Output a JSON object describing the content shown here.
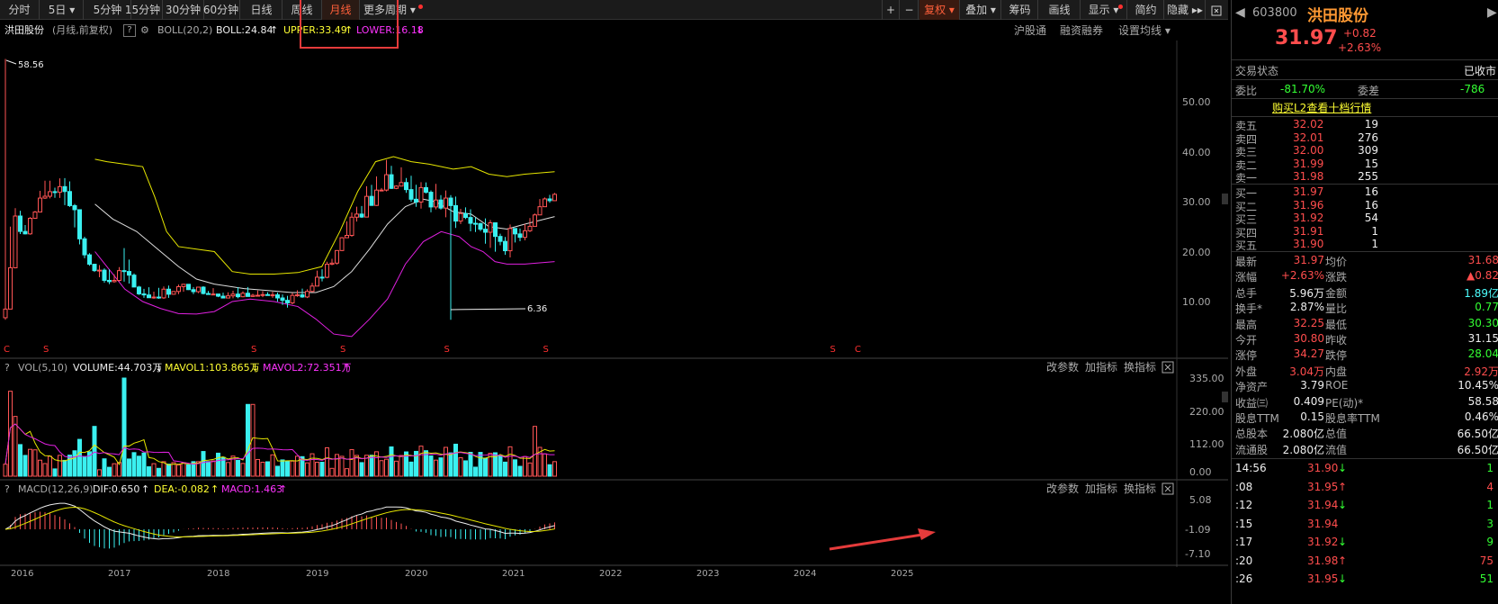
{
  "toolbar": {
    "items": [
      "分时",
      "5日",
      "5分钟",
      "15分钟",
      "30分钟",
      "60分钟",
      "日线",
      "周线",
      "月线",
      "更多周期"
    ],
    "right": [
      "+",
      "−",
      "复权",
      "叠加",
      "筹码",
      "画线",
      "显示",
      "简约",
      "隐藏"
    ]
  },
  "info": {
    "name": "洪田股份",
    "mode": "(月线,前复权)",
    "help": "?",
    "boll": "BOLL(20,2)",
    "boll_val": "BOLL:24.84",
    "upper": "UPPER:33.49",
    "lower": "LOWER:16.18",
    "links": [
      "沪股通",
      "融资融券",
      "设置均线"
    ]
  },
  "price_axis": [
    "50.00",
    "40.00",
    "30.00",
    "20.00",
    "10.00"
  ],
  "annot": {
    "high": "58.56",
    "low": "6.36"
  },
  "vol": {
    "title": "VOL(5,10)",
    "volume": "VOLUME:44.703万",
    "mavol1": "MAVOL1:103.865万",
    "mavol2": "MAVOL2:72.351万",
    "axis": [
      "335.00",
      "220.00",
      "112.00",
      "0.00"
    ]
  },
  "macd": {
    "title": "MACD(12,26,9)",
    "dif": "DIF:0.650",
    "dea": "DEA:-0.082",
    "macd": "MACD:1.463",
    "axis": [
      "5.08",
      "-1.09",
      "-7.10"
    ]
  },
  "sub_links": [
    "改参数",
    "加指标",
    "换指标"
  ],
  "years": [
    "2016",
    "2017",
    "2018",
    "2019",
    "2020",
    "2021",
    "2022",
    "2023",
    "2024",
    "2025"
  ],
  "sidebar": {
    "code": "603800",
    "name": "洪田股份",
    "price": "31.97",
    "chg": "+0.82",
    "pct": "+2.63%",
    "status_label": "交易状态",
    "status": "已收市",
    "webi_label": "委比",
    "webi": "-81.70%",
    "wecha_label": "委差",
    "wecha": "-786",
    "l2": "购买L2查看十档行情",
    "asks": [
      {
        "l": "卖五",
        "p": "32.02",
        "v": "19"
      },
      {
        "l": "卖四",
        "p": "32.01",
        "v": "276"
      },
      {
        "l": "卖三",
        "p": "32.00",
        "v": "309"
      },
      {
        "l": "卖二",
        "p": "31.99",
        "v": "15"
      },
      {
        "l": "卖一",
        "p": "31.98",
        "v": "255"
      }
    ],
    "bids": [
      {
        "l": "买一",
        "p": "31.97",
        "v": "16"
      },
      {
        "l": "买二",
        "p": "31.96",
        "v": "16"
      },
      {
        "l": "买三",
        "p": "31.92",
        "v": "54"
      },
      {
        "l": "买四",
        "p": "31.91",
        "v": "1"
      },
      {
        "l": "买五",
        "p": "31.90",
        "v": "1"
      }
    ],
    "stats": [
      {
        "l1": "最新",
        "v1": "31.97",
        "l2": "均价",
        "v2": "31.68"
      },
      {
        "l1": "涨幅",
        "v1": "+2.63%",
        "l2": "涨跌",
        "v2": "▲0.82"
      },
      {
        "l1": "总手",
        "v1": "5.96万",
        "l2": "金额",
        "v2": "1.89亿"
      },
      {
        "l1": "换手*",
        "v1": "2.87%",
        "l2": "量比",
        "v2": "0.77"
      },
      {
        "l1": "最高",
        "v1": "32.25",
        "l2": "最低",
        "v2": "30.30"
      },
      {
        "l1": "今开",
        "v1": "30.80",
        "l2": "昨收",
        "v2": "31.15"
      },
      {
        "l1": "涨停",
        "v1": "34.27",
        "l2": "跌停",
        "v2": "28.04"
      },
      {
        "l1": "外盘",
        "v1": "3.04万",
        "l2": "内盘",
        "v2": "2.92万"
      },
      {
        "l1": "净资产",
        "v1": "3.79",
        "l2": "ROE",
        "v2": "10.45%"
      },
      {
        "l1": "收益㈢",
        "v1": "0.409",
        "l2": "PE(动)*",
        "v2": "58.58"
      },
      {
        "l1": "股息TTM",
        "v1": "0.15",
        "l2": "股息率TTM",
        "v2": "0.46%"
      },
      {
        "l1": "总股本",
        "v1": "2.080亿",
        "l2": "总值",
        "v2": "66.50亿"
      },
      {
        "l1": "流通股",
        "v1": "2.080亿",
        "l2": "流值",
        "v2": "66.50亿"
      }
    ],
    "ticks": [
      {
        "t": "14:56",
        "p": "31.90",
        "a": "↓",
        "v": "1"
      },
      {
        "t": ":08",
        "p": "31.95",
        "a": "↑",
        "v": "4"
      },
      {
        "t": ":12",
        "p": "31.94",
        "a": "↓",
        "v": "1"
      },
      {
        "t": ":15",
        "p": "31.94",
        "a": "",
        "v": "3"
      },
      {
        "t": ":17",
        "p": "31.92",
        "a": "↓",
        "v": "9"
      },
      {
        "t": ":20",
        "p": "31.98",
        "a": "↑",
        "v": "75"
      },
      {
        "t": ":26",
        "p": "31.95",
        "a": "↓",
        "v": "51"
      }
    ]
  },
  "chart_data": {
    "type": "candlestick",
    "months": 112,
    "price_range": [
      0,
      60
    ],
    "anchors": [
      [
        0,
        7,
        58.6,
        4
      ],
      [
        3,
        26,
        32,
        24
      ],
      [
        6,
        24,
        28,
        22
      ],
      [
        10,
        28,
        30,
        26
      ],
      [
        14,
        32,
        38,
        30
      ],
      [
        17,
        33,
        40,
        30
      ],
      [
        20,
        34,
        52,
        26
      ],
      [
        23,
        27,
        32,
        22
      ],
      [
        26,
        20,
        24,
        18
      ],
      [
        30,
        17,
        20,
        15
      ],
      [
        34,
        14,
        17,
        12
      ],
      [
        39,
        15,
        27,
        13
      ],
      [
        44,
        12,
        14,
        10
      ],
      [
        49,
        11,
        14,
        10
      ],
      [
        54,
        12,
        14,
        10
      ],
      [
        60,
        13,
        14,
        11
      ],
      [
        68,
        12,
        14,
        11
      ],
      [
        76,
        11,
        14,
        10
      ],
      [
        84,
        12,
        14,
        11
      ],
      [
        89,
        11,
        13,
        10
      ],
      [
        93,
        9,
        12,
        6.4
      ],
      [
        97,
        11,
        13,
        10
      ],
      [
        102,
        12,
        14,
        11
      ],
      [
        107,
        16,
        22,
        14
      ],
      [
        112,
        22,
        28,
        20
      ],
      [
        116,
        26,
        32,
        24
      ],
      [
        122,
        30,
        38,
        28
      ],
      [
        127,
        36,
        45,
        33
      ],
      [
        132,
        33,
        40,
        30
      ],
      [
        138,
        31,
        38,
        28
      ],
      [
        144,
        30,
        36,
        26
      ],
      [
        150,
        28,
        34,
        24
      ],
      [
        156,
        26,
        30,
        22
      ],
      [
        162,
        24,
        28,
        18
      ],
      [
        168,
        22,
        26,
        16
      ],
      [
        172,
        24,
        27,
        18
      ],
      [
        176,
        26,
        30,
        24
      ],
      [
        180,
        30,
        36,
        28
      ],
      [
        184,
        31,
        32,
        30
      ]
    ],
    "boll_upper": [
      [
        30,
        38.5
      ],
      [
        34,
        38
      ],
      [
        40,
        37.5
      ],
      [
        46,
        37
      ],
      [
        50,
        31
      ],
      [
        54,
        24
      ],
      [
        58,
        21
      ],
      [
        64,
        20.5
      ],
      [
        70,
        20
      ],
      [
        76,
        16
      ],
      [
        82,
        15.5
      ],
      [
        90,
        15.5
      ],
      [
        98,
        15.8
      ],
      [
        106,
        17
      ],
      [
        112,
        24
      ],
      [
        118,
        32
      ],
      [
        124,
        38
      ],
      [
        130,
        39
      ],
      [
        136,
        38
      ],
      [
        142,
        37.5
      ],
      [
        146,
        37
      ],
      [
        150,
        36.5
      ],
      [
        156,
        37
      ],
      [
        162,
        35.5
      ],
      [
        168,
        35
      ],
      [
        174,
        35.5
      ],
      [
        184,
        36
      ]
    ],
    "boll_mid": [
      [
        30,
        29.5
      ],
      [
        36,
        26.5
      ],
      [
        44,
        24
      ],
      [
        52,
        20
      ],
      [
        58,
        17
      ],
      [
        64,
        14.5
      ],
      [
        70,
        13.5
      ],
      [
        80,
        12.6
      ],
      [
        88,
        12.2
      ],
      [
        96,
        11.8
      ],
      [
        104,
        11.8
      ],
      [
        110,
        13
      ],
      [
        116,
        16
      ],
      [
        122,
        20.5
      ],
      [
        128,
        25.5
      ],
      [
        134,
        29
      ],
      [
        140,
        30.5
      ],
      [
        144,
        30
      ],
      [
        150,
        28
      ],
      [
        156,
        27.5
      ],
      [
        162,
        25
      ],
      [
        168,
        24.5
      ],
      [
        174,
        25.5
      ],
      [
        184,
        27
      ]
    ],
    "boll_lower": [
      [
        30,
        20
      ],
      [
        34,
        17
      ],
      [
        40,
        12.5
      ],
      [
        46,
        10
      ],
      [
        52,
        8.6
      ],
      [
        58,
        7.6
      ],
      [
        64,
        7.5
      ],
      [
        70,
        8
      ],
      [
        76,
        10
      ],
      [
        82,
        10.5
      ],
      [
        90,
        10
      ],
      [
        98,
        9
      ],
      [
        104,
        6.5
      ],
      [
        110,
        3.5
      ],
      [
        116,
        3
      ],
      [
        122,
        6.5
      ],
      [
        128,
        10.5
      ],
      [
        134,
        17.5
      ],
      [
        140,
        22
      ],
      [
        146,
        24
      ],
      [
        152,
        23
      ],
      [
        156,
        21
      ],
      [
        160,
        20
      ],
      [
        164,
        18
      ],
      [
        168,
        17.5
      ],
      [
        174,
        17.5
      ],
      [
        184,
        18
      ]
    ],
    "vol_range": [
      0,
      335
    ],
    "macd_range": [
      -7.1,
      5.08
    ]
  }
}
